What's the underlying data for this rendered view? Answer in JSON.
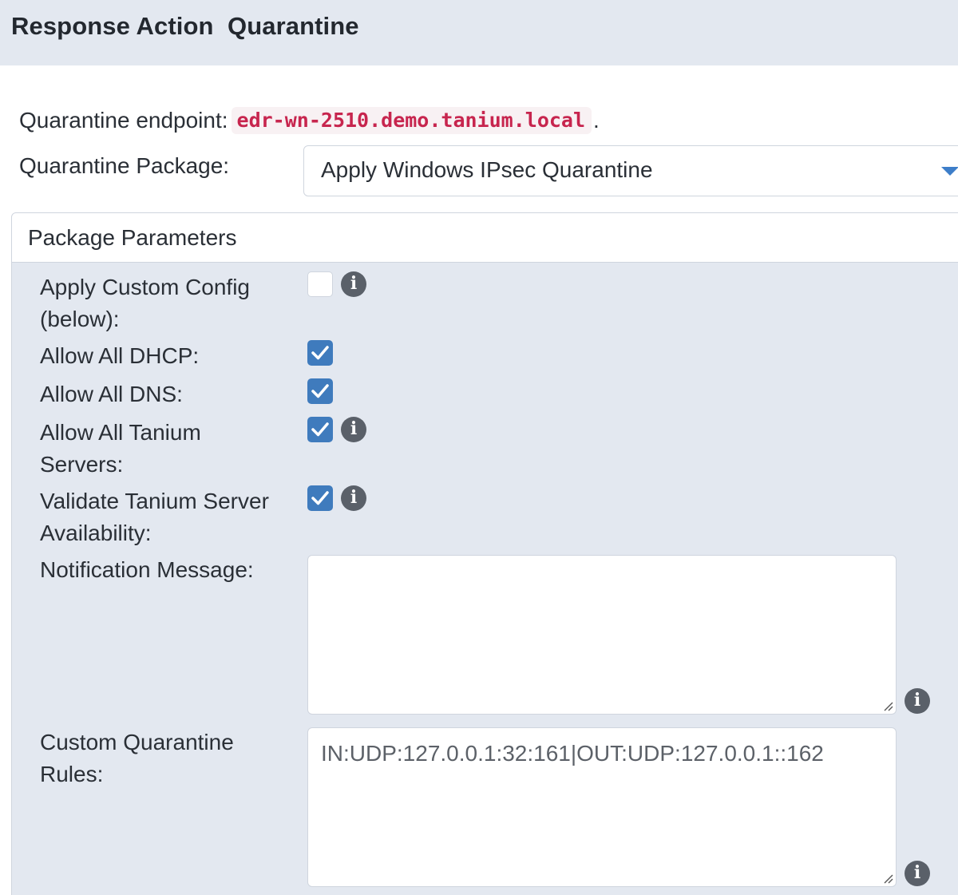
{
  "header": {
    "title": "Response Action  Quarantine"
  },
  "endpoint": {
    "label": "Quarantine endpoint:",
    "hostname": "edr-wn-2510.demo.tanium.local",
    "suffix": "."
  },
  "package": {
    "label": "Quarantine Package:",
    "selected": "Apply Windows IPsec Quarantine"
  },
  "parameters": {
    "title": "Package Parameters",
    "apply_custom_config": {
      "label": "Apply Custom Config (below):",
      "checked": false
    },
    "allow_all_dhcp": {
      "label": "Allow All DHCP:",
      "checked": true
    },
    "allow_all_dns": {
      "label": "Allow All DNS:",
      "checked": true
    },
    "allow_all_tanium_servers": {
      "label": "Allow All Tanium Servers:",
      "checked": true
    },
    "validate_tanium_server": {
      "label": "Validate Tanium Server Availability:",
      "checked": true
    },
    "notification_message": {
      "label": "Notification Message:",
      "value": ""
    },
    "custom_quarantine_rules": {
      "label": "Custom Quarantine Rules:",
      "value": "IN:UDP:127.0.0.1:32:161|OUT:UDP:127.0.0.1::162"
    }
  },
  "colors": {
    "accent": "#3f7bbd",
    "hostname": "#c7254e",
    "panel_bg": "#e3e8f0"
  },
  "icons": {
    "info": "info-icon",
    "check": "check-icon",
    "caret": "caret-down-icon"
  }
}
